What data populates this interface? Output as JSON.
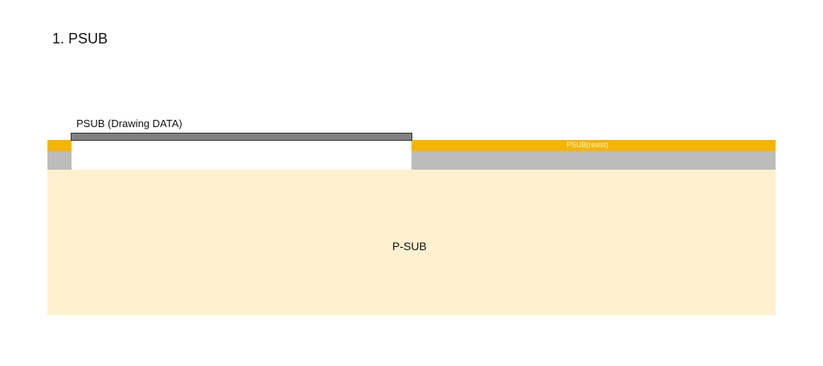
{
  "step": {
    "title": "1. PSUB"
  },
  "diagram": {
    "mask_label": "PSUB (Drawing DATA)",
    "resist_label": "PSUB(resist)",
    "substrate_label": "P-SUB",
    "colors": {
      "substrate": "#fff1cf",
      "resist": "#f5b400",
      "oxide": "#bcbcbc",
      "mask": "#808080",
      "opening": "#ffffff"
    }
  }
}
